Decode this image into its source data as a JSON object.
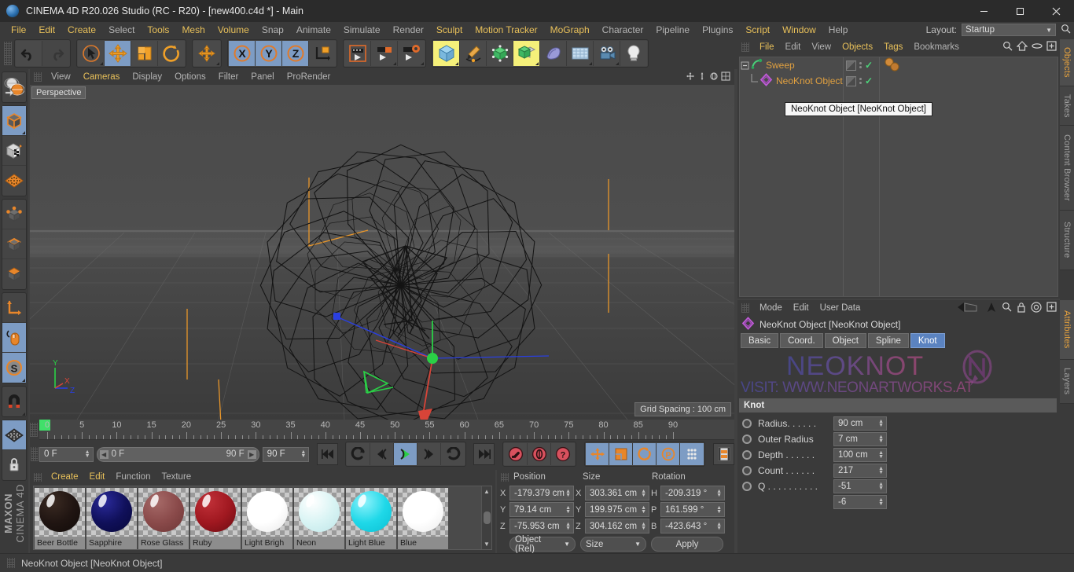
{
  "window": {
    "title": "CINEMA 4D R20.026 Studio (RC - R20) - [new400.c4d *] - Main",
    "minimize": "—",
    "maximize": "☐",
    "close": "✕"
  },
  "menubar": {
    "items": [
      {
        "label": "File",
        "hl": true
      },
      {
        "label": "Edit",
        "hl": true
      },
      {
        "label": "Create",
        "hl": true
      },
      {
        "label": "Select",
        "hl": false
      },
      {
        "label": "Tools",
        "hl": true
      },
      {
        "label": "Mesh",
        "hl": true
      },
      {
        "label": "Volume",
        "hl": true
      },
      {
        "label": "Snap",
        "hl": false
      },
      {
        "label": "Animate",
        "hl": false
      },
      {
        "label": "Simulate",
        "hl": false
      },
      {
        "label": "Render",
        "hl": false
      },
      {
        "label": "Sculpt",
        "hl": true
      },
      {
        "label": "Motion Tracker",
        "hl": true
      },
      {
        "label": "MoGraph",
        "hl": true
      },
      {
        "label": "Character",
        "hl": false
      },
      {
        "label": "Pipeline",
        "hl": false
      },
      {
        "label": "Plugins",
        "hl": false
      },
      {
        "label": "Script",
        "hl": true
      },
      {
        "label": "Window",
        "hl": true
      },
      {
        "label": "Help",
        "hl": false
      }
    ],
    "layout_label": "Layout:",
    "layout_value": "Startup"
  },
  "viewport": {
    "menu": [
      {
        "label": "View",
        "hl": false
      },
      {
        "label": "Cameras",
        "hl": true
      },
      {
        "label": "Display",
        "hl": false
      },
      {
        "label": "Options",
        "hl": false
      },
      {
        "label": "Filter",
        "hl": false
      },
      {
        "label": "Panel",
        "hl": false
      },
      {
        "label": "ProRender",
        "hl": false
      }
    ],
    "label": "Perspective",
    "grid_spacing": "Grid Spacing : 100 cm",
    "axis": {
      "x": "X",
      "y": "Y",
      "z": "Z"
    }
  },
  "timeline": {
    "ticks": [
      "0",
      "5",
      "10",
      "15",
      "20",
      "25",
      "30",
      "35",
      "40",
      "45",
      "50",
      "55",
      "60",
      "65",
      "70",
      "75",
      "80",
      "85",
      "90"
    ],
    "current_frame": "0 F",
    "range_start": "0 F",
    "range_end": "90 F",
    "end_frame": "90 F",
    "preview_frame": "0 F"
  },
  "material_manager": {
    "menu": [
      {
        "label": "Create",
        "hl": true
      },
      {
        "label": "Edit",
        "hl": true
      },
      {
        "label": "Function",
        "hl": false
      },
      {
        "label": "Texture",
        "hl": false
      }
    ],
    "materials": [
      {
        "name": "Beer Bottle",
        "color": "#201512",
        "top": "#3a2a22",
        "bottom": "#110b09"
      },
      {
        "name": "Sapphire",
        "color": "#10105a",
        "top": "#2a2a9a",
        "bottom": "#07073a"
      },
      {
        "name": "Rose Glass",
        "color": "#8a4a4a",
        "top": "#a66a68",
        "bottom": "#6d3636"
      },
      {
        "name": "Ruby",
        "color": "#a01820",
        "top": "#c03038",
        "bottom": "#6a0c12"
      },
      {
        "name": "Light Brigh",
        "color": "#ffffff",
        "top": "#ffffff",
        "bottom": "#e8e8e8"
      },
      {
        "name": "Neon",
        "color": "#d9f4f4",
        "top": "#ffffff",
        "bottom": "#bfe6e8"
      },
      {
        "name": "Light Blue",
        "color": "#1fd8e8",
        "top": "#8ef2fb",
        "bottom": "#0bc0d4"
      },
      {
        "name": "Blue",
        "color": "#ffffff",
        "top": "#ffffff",
        "bottom": "#ececec"
      }
    ]
  },
  "coordinates": {
    "headers": {
      "position": "Position",
      "size": "Size",
      "rotation": "Rotation"
    },
    "rows": [
      {
        "pl": "X",
        "pv": "-179.379 cm",
        "sl": "X",
        "sv": "303.361 cm",
        "rl": "H",
        "rv": "-209.319 °"
      },
      {
        "pl": "Y",
        "pv": "79.14 cm",
        "sl": "Y",
        "sv": "199.975 cm",
        "rl": "P",
        "rv": "161.599 °"
      },
      {
        "pl": "Z",
        "pv": "-75.953 cm",
        "sl": "Z",
        "sv": "304.162 cm",
        "rl": "B",
        "rv": "-423.643 °"
      }
    ],
    "mode_select": "Object (Rel)",
    "size_select": "Size",
    "apply_button": "Apply"
  },
  "object_manager": {
    "menu": [
      {
        "label": "File",
        "hl": true
      },
      {
        "label": "Edit",
        "hl": false
      },
      {
        "label": "View",
        "hl": false
      },
      {
        "label": "Objects",
        "hl": true
      },
      {
        "label": "Tags",
        "hl": true
      },
      {
        "label": "Bookmarks",
        "hl": false
      }
    ],
    "objects": [
      {
        "name": "Sweep",
        "indent": 0,
        "icon": "sweep-spline-icon"
      },
      {
        "name": "NeoKnot Object",
        "indent": 1,
        "icon": "neoknot-object-icon"
      }
    ],
    "tooltip": "NeoKnot Object [NeoKnot Object]"
  },
  "attributes": {
    "menu": [
      {
        "label": "Mode"
      },
      {
        "label": "Edit"
      },
      {
        "label": "User Data"
      }
    ],
    "title": "NeoKnot Object [NeoKnot Object]",
    "tabs": [
      {
        "label": "Basic",
        "active": false
      },
      {
        "label": "Coord.",
        "active": false
      },
      {
        "label": "Object",
        "active": false
      },
      {
        "label": "Spline",
        "active": false
      },
      {
        "label": "Knot",
        "active": true
      }
    ],
    "watermark_line1": "NEOKNOT",
    "watermark_line2": "VISIT: WWW.NEONARTWORKS.AT",
    "section": "Knot",
    "params": [
      {
        "label": "Radius. . . . . .",
        "value": "90 cm"
      },
      {
        "label": "Outer Radius",
        "value": "7 cm"
      },
      {
        "label": "Depth . . . . . .",
        "value": "100 cm"
      },
      {
        "label": "Count . . . . . .",
        "value": "217"
      },
      {
        "label": "Q . . . . . . . . . .",
        "value": "-51"
      },
      {
        "label": "",
        "value": "-6"
      }
    ]
  },
  "vtabs_top": [
    "Objects",
    "Takes",
    "Content Browser",
    "Structure"
  ],
  "vtabs_bottom": [
    "Attributes",
    "Layers"
  ],
  "branding": {
    "maxon": "MAXON",
    "c4d": "CINEMA 4D"
  },
  "statusbar": {
    "text": "NeoKnot Object [NeoKnot Object]"
  },
  "colors": {
    "accent_orange": "#e8a33d",
    "menu_highlight": "#e8c05a",
    "panel_bg": "#3a3a3a",
    "active_blue": "#7d9cc4",
    "tab_blue": "#5b83c0",
    "check_green": "#4cd47a",
    "object_name": "#e0a040"
  }
}
